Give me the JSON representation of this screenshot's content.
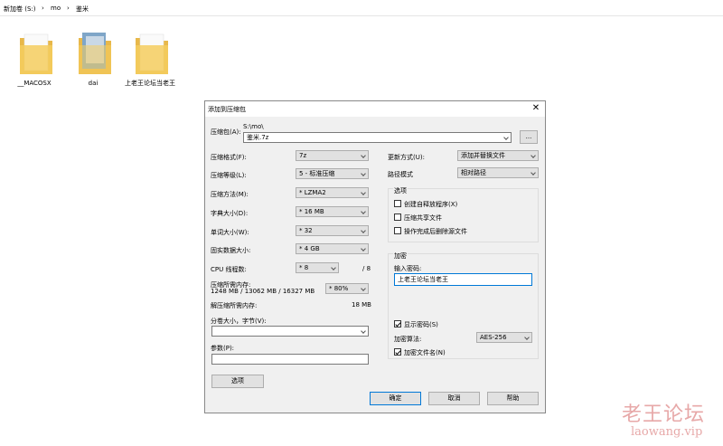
{
  "breadcrumb": {
    "drive": "新加卷 (S:)",
    "sep1": "›",
    "folder": "mo",
    "sep2": "›",
    "current": "鉴米"
  },
  "files": [
    {
      "name": "__MACOSX",
      "icon": "folder-icon"
    },
    {
      "name": "dai",
      "icon": "folder-with-image-icon"
    },
    {
      "name": "上老王论坛当老王",
      "icon": "folder-icon"
    }
  ],
  "dialog": {
    "title": "添加到压缩包",
    "close": "✕",
    "archive_label": "压缩包(A):",
    "archive_path": "S:\\mo\\",
    "archive_name": "鉴米.7z",
    "browse": "...",
    "format_label": "压缩格式(F):",
    "format_value": "7z",
    "level_label": "压缩等级(L):",
    "level_value": "5 - 标准压缩",
    "method_label": "压缩方法(M):",
    "method_value": "* LZMA2",
    "dict_label": "字典大小(D):",
    "dict_value": "* 16 MB",
    "word_label": "单词大小(W):",
    "word_value": "* 32",
    "solid_label": "固实数据大小:",
    "solid_value": "* 4 GB",
    "cpu_label": "CPU 线程数:",
    "cpu_value": "* 8",
    "cpu_total": "/ 8",
    "mem_label": "压缩所需内存:",
    "mem_detail": "1248 MB / 13062 MB / 16327 MB",
    "mem_value": "* 80%",
    "decomp_label": "解压缩所需内存:",
    "decomp_value": "18 MB",
    "split_label": "分卷大小，字节(V):",
    "split_value": "",
    "params_label": "参数(P):",
    "params_value": "",
    "options_btn": "选项",
    "update_label": "更新方式(U):",
    "update_value": "添加并替换文件",
    "path_label": "路径模式",
    "path_value": "相对路径",
    "options_group": "选项",
    "opt_sfx": "创建自释放程序(X)",
    "opt_shared": "压缩共享文件",
    "opt_delete": "操作完成后删除源文件",
    "encrypt_group": "加密",
    "pwd_label": "输入密码:",
    "pwd_value": "上老王论坛当老王",
    "show_pwd": "显示密码(S)",
    "enc_method_label": "加密算法:",
    "enc_method_value": "AES-256",
    "enc_names": "加密文件名(N)",
    "ok": "确定",
    "cancel": "取消",
    "help": "帮助"
  },
  "watermark": {
    "title": "老王论坛",
    "url": "laowang.vip"
  }
}
